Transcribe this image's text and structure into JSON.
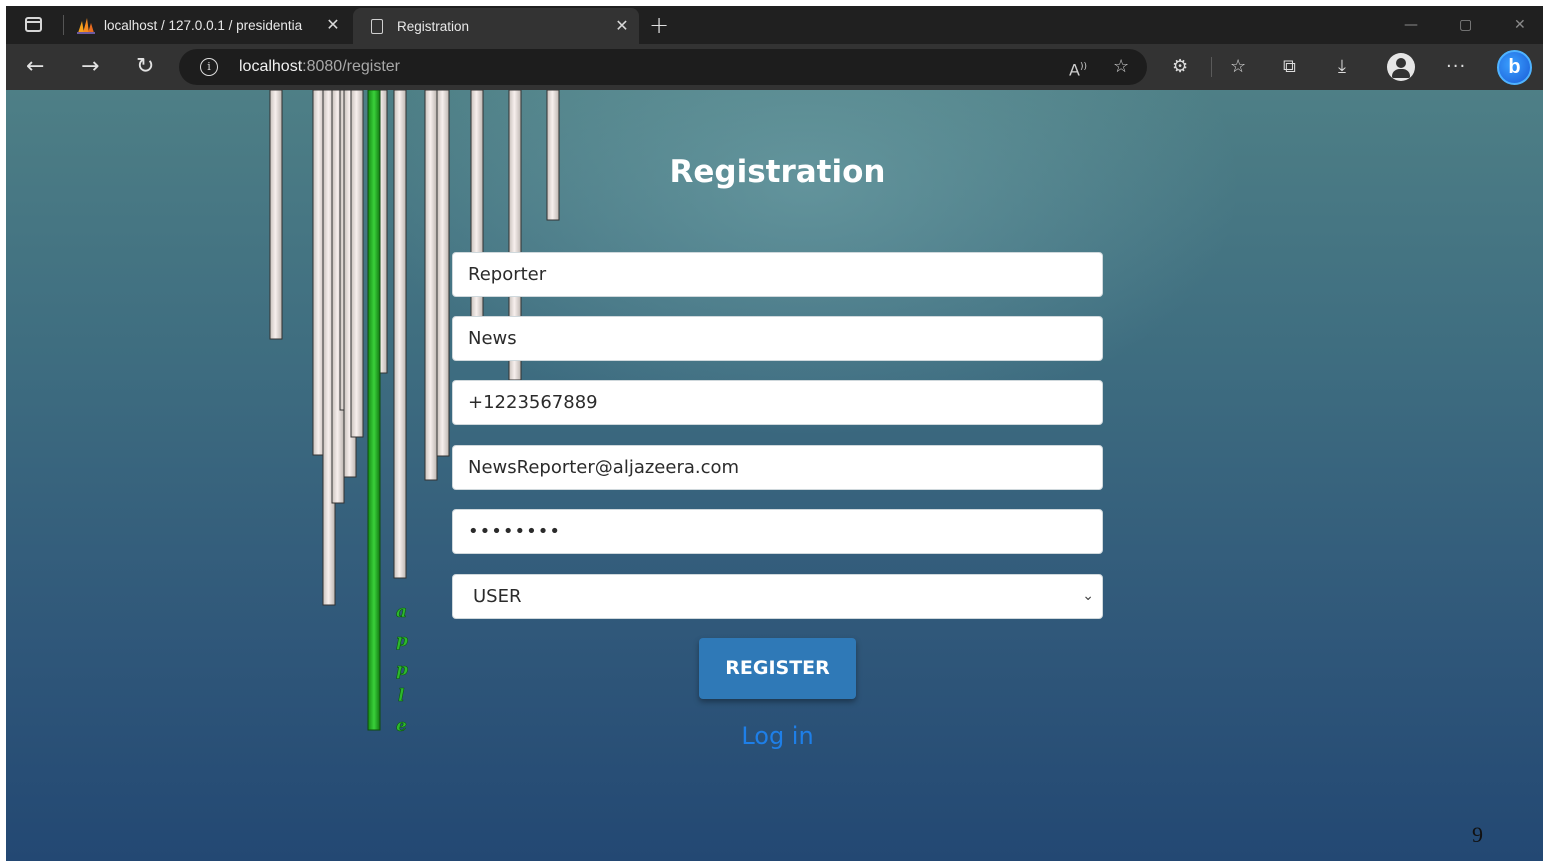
{
  "browser": {
    "tabs": [
      {
        "title": "localhost / 127.0.0.1 / presidentia",
        "close": "✕"
      },
      {
        "title": "Registration",
        "close": "✕"
      }
    ],
    "new_tab": "+",
    "window": {
      "minimize": "—",
      "maximize": "▢",
      "close": "✕"
    },
    "nav": {
      "back": "←",
      "forward": "→",
      "reload": "↻"
    },
    "address": {
      "host": "localhost",
      "rest": ":8080/register"
    },
    "icons": [
      "tab-actions-icon",
      "phpmyadmin-favicon",
      "page-icon",
      "info-icon",
      "read-aloud-icon",
      "favorite-add-icon",
      "extensions-icon",
      "favorites-icon",
      "collections-icon",
      "downloads-icon",
      "profile-icon",
      "more-icon",
      "bing-copilot-icon"
    ],
    "more": "···",
    "bing": "b"
  },
  "page": {
    "title": "Registration",
    "form": {
      "first_name": "Reporter",
      "last_name": "News",
      "phone": "+1223567889",
      "email": "NewsReporter@aljazeera.com",
      "password_masked": "••••••••",
      "role": "USER",
      "register_label": "REGISTER",
      "login_link": "Log in"
    },
    "background_text": "apple"
  },
  "slide_number": "9",
  "colors": {
    "accent_button": "#2f79b7",
    "link": "#1e7fe8",
    "bg_top": "#4e7f86",
    "bg_bottom": "#234873",
    "green_bar": "#22b022"
  }
}
